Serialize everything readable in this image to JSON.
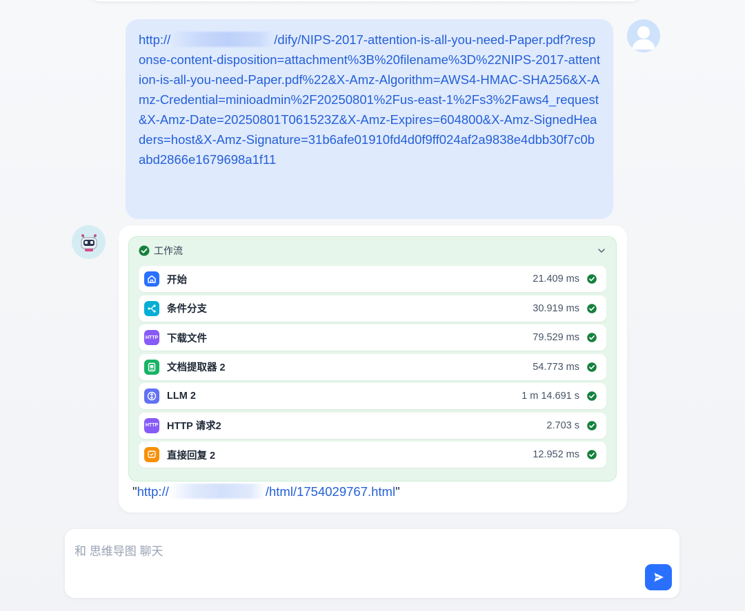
{
  "user_message": {
    "prefix": "http://",
    "url_text": "/dify/NIPS-2017-attention-is-all-you-need-Paper.pdf?response-content-disposition=attachment%3B%20filename%3D%22NIPS-2017-attention-is-all-you-need-Paper.pdf%22&X-Amz-Algorithm=AWS4-HMAC-SHA256&X-Amz-Credential=minioadmin%2F20250801%2Fus-east-1%2Fs3%2Faws4_request&X-Amz-Date=20250801T061523Z&X-Amz-Expires=604800&X-Amz-SignedHeaders=host&X-Amz-Signature=31b6afe01910fd4d0f9ff024af2a9838e4dbb30f7c0babd2866e1679698a1f11"
  },
  "workflow": {
    "title": "工作流",
    "status_color": "#16a34a",
    "nodes": [
      {
        "name": "开始",
        "time": "21.409 ms",
        "icon": "home-icon",
        "color": "#2970ff"
      },
      {
        "name": "条件分支",
        "time": "30.919 ms",
        "icon": "branch-icon",
        "color": "#06aed4"
      },
      {
        "name": "下载文件",
        "time": "79.529 ms",
        "icon": "http-icon",
        "icon_text": "HTTP",
        "color": "#875bf7"
      },
      {
        "name": "文档提取器 2",
        "time": "54.773 ms",
        "icon": "doc-extractor-icon",
        "color": "#16b364"
      },
      {
        "name": "LLM 2",
        "time": "1 m 14.691 s",
        "icon": "llm-icon",
        "color": "#6172f3"
      },
      {
        "name": "HTTP 请求2",
        "time": "2.703 s",
        "icon": "http-icon",
        "icon_text": "HTTP",
        "color": "#875bf7"
      },
      {
        "name": "直接回复 2",
        "time": "12.952 ms",
        "icon": "answer-icon",
        "color": "#f79009"
      }
    ]
  },
  "result": {
    "open_quote": "\"",
    "prefix": "http://",
    "path": "/html/1754029767.html",
    "close_quote": "\""
  },
  "input": {
    "placeholder": "和 思维导图 聊天"
  }
}
